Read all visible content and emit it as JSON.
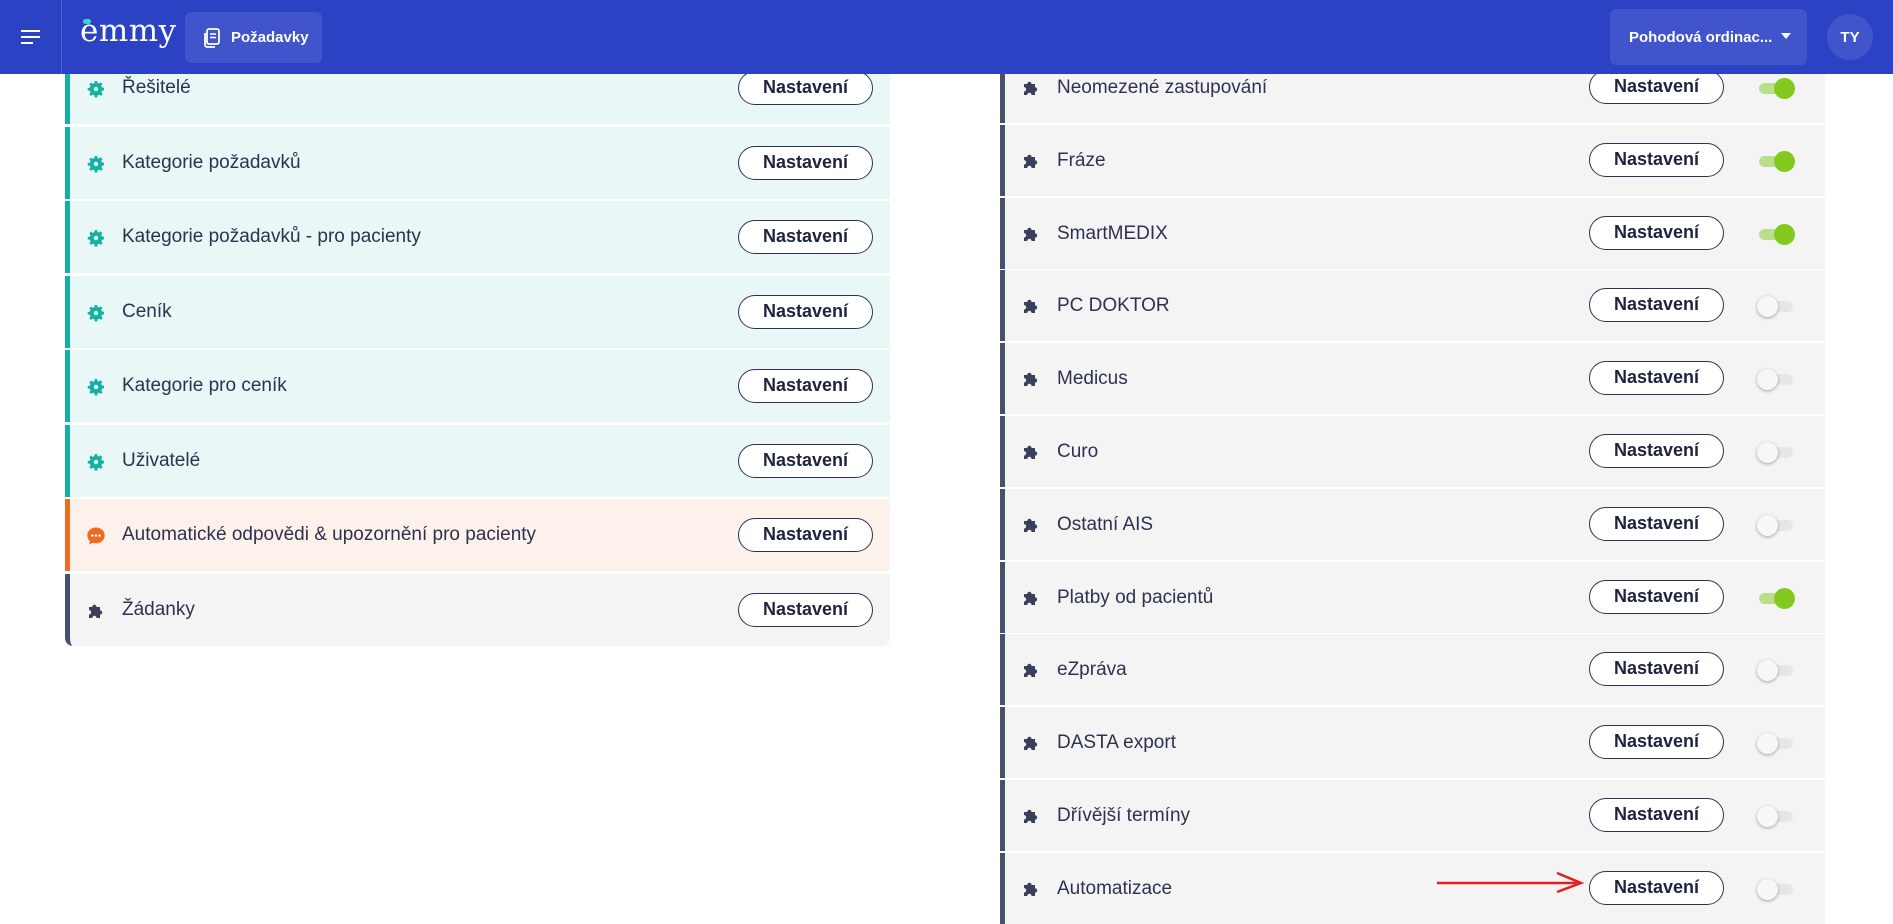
{
  "header": {
    "logo_text": "emmy",
    "nav_button_label": "Požadavky",
    "org_select_value": "Pohodová ordinac...",
    "avatar_initials": "TY",
    "accent_color": "#2c42c4"
  },
  "left_list": {
    "items": [
      {
        "label": "Řešitelé",
        "button": "Nastavení",
        "icon": "gear-icon",
        "variant": "teal"
      },
      {
        "label": "Kategorie požadavků",
        "button": "Nastavení",
        "icon": "gear-icon",
        "variant": "teal"
      },
      {
        "label": "Kategorie požadavků - pro pacienty",
        "button": "Nastavení",
        "icon": "gear-icon",
        "variant": "teal"
      },
      {
        "label": "Ceník",
        "button": "Nastavení",
        "icon": "gear-icon",
        "variant": "teal"
      },
      {
        "label": "Kategorie pro ceník",
        "button": "Nastavení",
        "icon": "gear-icon",
        "variant": "teal"
      },
      {
        "label": "Uživatelé",
        "button": "Nastavení",
        "icon": "gear-icon",
        "variant": "teal"
      },
      {
        "label": "Automatické odpovědi & upozornění pro pacienty",
        "button": "Nastavení",
        "icon": "chat-icon",
        "variant": "orange"
      },
      {
        "label": "Žádanky",
        "button": "Nastavení",
        "icon": "puzzle-icon",
        "variant": "gray"
      }
    ]
  },
  "right_list": {
    "items": [
      {
        "label": "Neomezené zastupování",
        "button": "Nastavení",
        "icon": "puzzle-icon",
        "enabled": true
      },
      {
        "label": "Fráze",
        "button": "Nastavení",
        "icon": "puzzle-icon",
        "enabled": true
      },
      {
        "label": "SmartMEDIX",
        "button": "Nastavení",
        "icon": "puzzle-icon",
        "enabled": true
      },
      {
        "label": "PC DOKTOR",
        "button": "Nastavení",
        "icon": "puzzle-icon",
        "enabled": false
      },
      {
        "label": "Medicus",
        "button": "Nastavení",
        "icon": "puzzle-icon",
        "enabled": false
      },
      {
        "label": "Curo",
        "button": "Nastavení",
        "icon": "puzzle-icon",
        "enabled": false
      },
      {
        "label": "Ostatní AIS",
        "button": "Nastavení",
        "icon": "puzzle-icon",
        "enabled": false
      },
      {
        "label": "Platby od pacientů",
        "button": "Nastavení",
        "icon": "puzzle-icon",
        "enabled": true
      },
      {
        "label": "eZpráva",
        "button": "Nastavení",
        "icon": "puzzle-icon",
        "enabled": false
      },
      {
        "label": "DASTA export",
        "button": "Nastavení",
        "icon": "puzzle-icon",
        "enabled": false
      },
      {
        "label": "Dřívější termíny",
        "button": "Nastavení",
        "icon": "puzzle-icon",
        "enabled": false
      },
      {
        "label": "Automatizace",
        "button": "Nastavení",
        "icon": "puzzle-icon",
        "enabled": false
      }
    ]
  },
  "annotation": {
    "icon": "red-arrow-icon",
    "color": "#e02020"
  }
}
